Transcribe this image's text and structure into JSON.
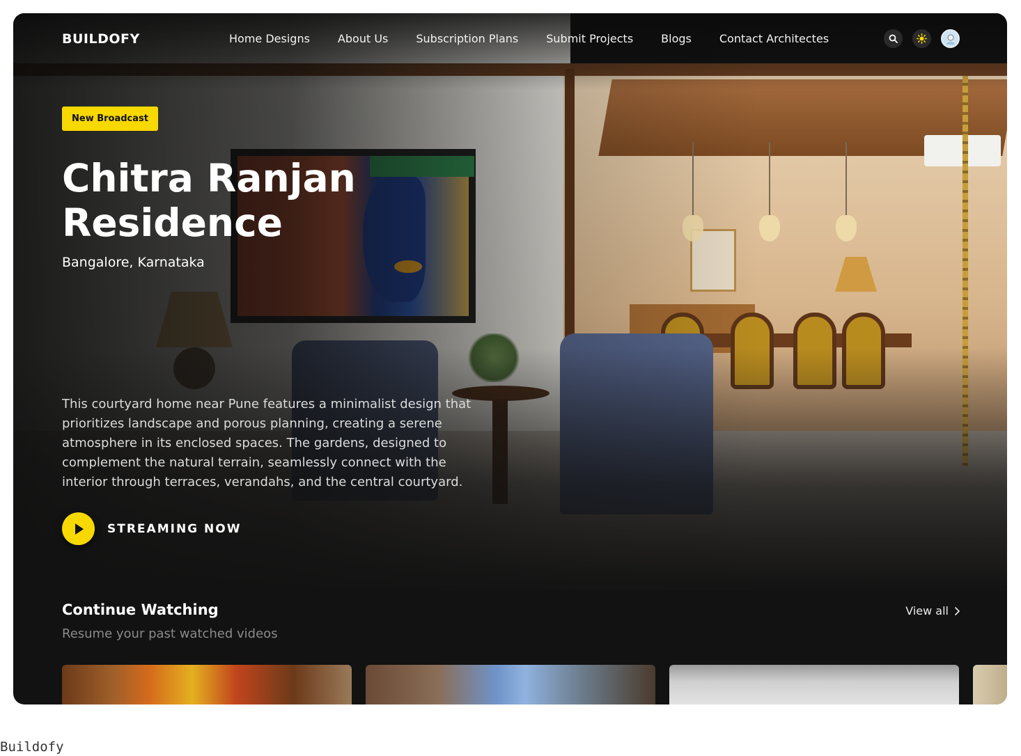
{
  "app": {
    "logo": "BUILDOFY"
  },
  "nav": {
    "items": [
      {
        "label": "Home Designs"
      },
      {
        "label": "About Us"
      },
      {
        "label": "Subscription Plans"
      },
      {
        "label": "Submit Projects"
      },
      {
        "label": "Blogs"
      },
      {
        "label": "Contact Architectes"
      }
    ],
    "icons": [
      "search-icon",
      "sun-icon",
      "avatar"
    ]
  },
  "hero": {
    "badge": "New Broadcast",
    "title": "Chitra Ranjan Residence",
    "location": "Bangalore, Karnataka",
    "description": "This courtyard home near Pune features a minimalist design that prioritizes landscape and porous planning, creating a serene atmosphere in its enclosed spaces. The gardens, designed to complement the natural terrain, seamlessly connect with the interior through terraces, verandahs, and the central courtyard.",
    "cta": "STREAMING NOW"
  },
  "continue_watching": {
    "title": "Continue Watching",
    "subtitle": "Resume your past watched videos",
    "view_all": "View all"
  },
  "caption": "Buildofy",
  "colors": {
    "accent": "#f7d800",
    "background": "#121212"
  }
}
